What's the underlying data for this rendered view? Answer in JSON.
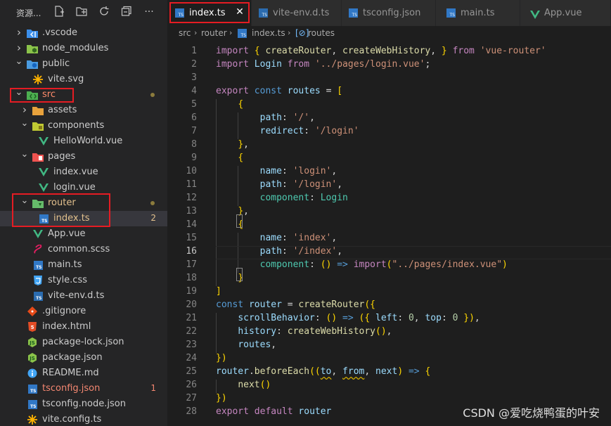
{
  "explorer": {
    "title": "资源...",
    "tools": [
      "new-file-icon",
      "new-folder-icon",
      "refresh-icon",
      "collapse-all-icon",
      "more-icon"
    ],
    "more_glyph": "···",
    "items": [
      {
        "label": ".vscode",
        "icon": "vscode-folder-icon",
        "type": "folder-collapsed"
      },
      {
        "label": "node_modules",
        "icon": "node-folder-icon",
        "type": "folder-collapsed"
      },
      {
        "label": "public",
        "icon": "public-folder-icon",
        "type": "folder-expanded"
      },
      {
        "label": "vite.svg",
        "icon": "vite-icon",
        "type": "file"
      },
      {
        "label": "src",
        "icon": "src-folder-icon",
        "type": "folder-expanded",
        "color": "#ff8c6b"
      },
      {
        "label": "assets",
        "icon": "folder-icon",
        "type": "folder-collapsed"
      },
      {
        "label": "components",
        "icon": "components-folder-icon",
        "type": "folder-expanded"
      },
      {
        "label": "HelloWorld.vue",
        "icon": "vue-icon",
        "type": "file"
      },
      {
        "label": "pages",
        "icon": "pages-folder-icon",
        "type": "folder-expanded"
      },
      {
        "label": "index.vue",
        "icon": "vue-icon",
        "type": "file"
      },
      {
        "label": "login.vue",
        "icon": "vue-icon",
        "type": "file"
      },
      {
        "label": "router",
        "icon": "router-folder-icon",
        "type": "folder-expanded",
        "color": "#e2c08d"
      },
      {
        "label": "index.ts",
        "icon": "ts-icon",
        "type": "file",
        "color": "#e2c08d",
        "badge": "2"
      },
      {
        "label": "App.vue",
        "icon": "vue-icon",
        "type": "file"
      },
      {
        "label": "common.scss",
        "icon": "sass-icon",
        "type": "file"
      },
      {
        "label": "main.ts",
        "icon": "ts-icon",
        "type": "file"
      },
      {
        "label": "style.css",
        "icon": "css-icon",
        "type": "file"
      },
      {
        "label": "vite-env.d.ts",
        "icon": "ts-def-icon",
        "type": "file"
      },
      {
        "label": ".gitignore",
        "icon": "git-icon",
        "type": "file"
      },
      {
        "label": "index.html",
        "icon": "html-icon",
        "type": "file"
      },
      {
        "label": "package-lock.json",
        "icon": "node-icon",
        "type": "file"
      },
      {
        "label": "package.json",
        "icon": "node-icon",
        "type": "file"
      },
      {
        "label": "README.md",
        "icon": "info-icon",
        "type": "file"
      },
      {
        "label": "tsconfig.json",
        "icon": "tsconfig-icon",
        "type": "file",
        "color": "#f48771",
        "badge": "1"
      },
      {
        "label": "tsconfig.node.json",
        "icon": "tsconfig-icon",
        "type": "file"
      },
      {
        "label": "vite.config.ts",
        "icon": "vite-icon",
        "type": "file"
      }
    ]
  },
  "tabs": [
    {
      "label": "index.ts",
      "icon": "ts-icon",
      "active": true,
      "close": "✕"
    },
    {
      "label": "vite-env.d.ts",
      "icon": "ts-def-icon"
    },
    {
      "label": "tsconfig.json",
      "icon": "tsconfig-icon"
    },
    {
      "label": "main.ts",
      "icon": "ts-icon"
    },
    {
      "label": "App.vue",
      "icon": "vue-icon"
    }
  ],
  "breadcrumb": [
    "src",
    "router",
    "index.ts",
    "routes"
  ],
  "editor": {
    "current_line": 16,
    "lines": [
      "import { createRouter, createWebHistory, } from 'vue-router'",
      "import Login from '../pages/login.vue';",
      "",
      "export const routes = [",
      "    {",
      "        path: '/',",
      "        redirect: '/login'",
      "    },",
      "    {",
      "        name: 'login',",
      "        path: '/login',",
      "        component: Login",
      "    },",
      "    {",
      "        name: 'index',",
      "        path: '/index',",
      "        component: () => import(\"../pages/index.vue\")",
      "    }",
      "]",
      "const router = createRouter({",
      "    scrollBehavior: () => ({ left: 0, top: 0 }),",
      "    history: createWebHistory(),",
      "    routes,",
      "})",
      "router.beforeEach((to, from, next) => {",
      "    next()",
      "})",
      "export default router"
    ]
  },
  "watermark": "CSDN @爱吃烧鸭蛋的叶安",
  "colors": {
    "accent_red": "#e51c23",
    "modified": "#e2c08d",
    "error": "#f48771"
  }
}
